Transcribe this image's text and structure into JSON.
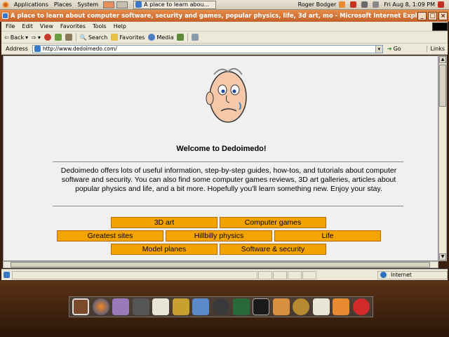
{
  "top_panel": {
    "menus": [
      "Applications",
      "Places",
      "System"
    ],
    "task_label": "A place to learn abou...",
    "user": "Roger Bodger",
    "clock": "Fri Aug  8,  1:09 PM"
  },
  "window": {
    "title": "A place to learn about computer software, security and games, popular physics, life, 3d art, mo - Microsoft Internet Explo",
    "btn_min": "_",
    "btn_max": "□",
    "btn_close": "×"
  },
  "menubar": [
    "File",
    "Edit",
    "View",
    "Favorites",
    "Tools",
    "Help"
  ],
  "toolbar": {
    "back": "Back",
    "search": "Search",
    "favorites": "Favorites",
    "media": "Media"
  },
  "address": {
    "label": "Address",
    "url": "http://www.dedoimedo.com/",
    "go": "Go",
    "links": "Links"
  },
  "page": {
    "welcome": "Welcome to Dedoimedo!",
    "intro": "Dedoimedo offers lots of useful information, step-by-step guides, how-tos, and tutorials about computer software and security. You can also find some computer games reviews, 3D art galleries, articles about popular physics and life, and a bit more. Hopefully you'll learn something new. Enjoy your stay.",
    "nav": {
      "art": "3D art",
      "games": "Computer games",
      "sites": "Greatest sites",
      "physics": "Hillbilly physics",
      "life": "Life",
      "planes": "Model planes",
      "security": "Software & security"
    }
  },
  "status": {
    "zone": "Internet"
  },
  "colors": {
    "nav_button": "#f4a400",
    "title_bar": "#d8722e",
    "desktop": "#3a200e"
  }
}
